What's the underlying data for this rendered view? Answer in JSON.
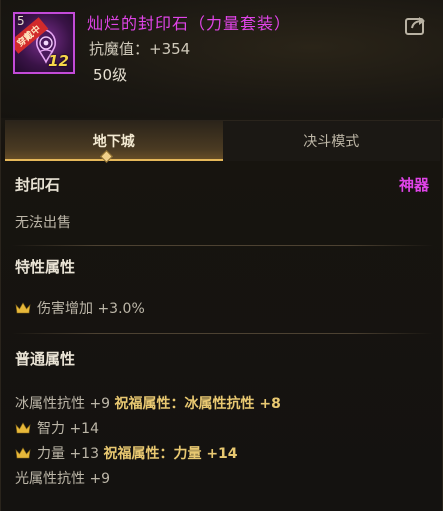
{
  "item": {
    "icon_level": "5",
    "badge": "穿戴中",
    "icon_number": "12",
    "name": "灿烂的封印石（力量套装）",
    "stat_label": "抗魔值：",
    "stat_value": "+354",
    "level": "50级"
  },
  "tabs": [
    {
      "label": "地下城",
      "active": true
    },
    {
      "label": "决斗模式",
      "active": false
    }
  ],
  "category": {
    "name": "封印石",
    "rarity": "神器",
    "note": "无法出售"
  },
  "special": {
    "title": "特性属性",
    "line1": {
      "icon": "crown-icon",
      "text": "伤害增加 +3.0%"
    }
  },
  "common": {
    "title": "普通属性",
    "line1_plain": "冰属性抗性 +9 ",
    "line1_bold": "祝福属性：冰属性抗性 +8",
    "line2": "智力 +14",
    "line3_plain": "力量 +13 ",
    "line3_bold": "祝福属性：力量 +14",
    "line4": "光属性抗性 +9"
  },
  "colors": {
    "name": "#e044e8",
    "gold": "#e8c871",
    "tab_accent": "#e6b85a"
  }
}
